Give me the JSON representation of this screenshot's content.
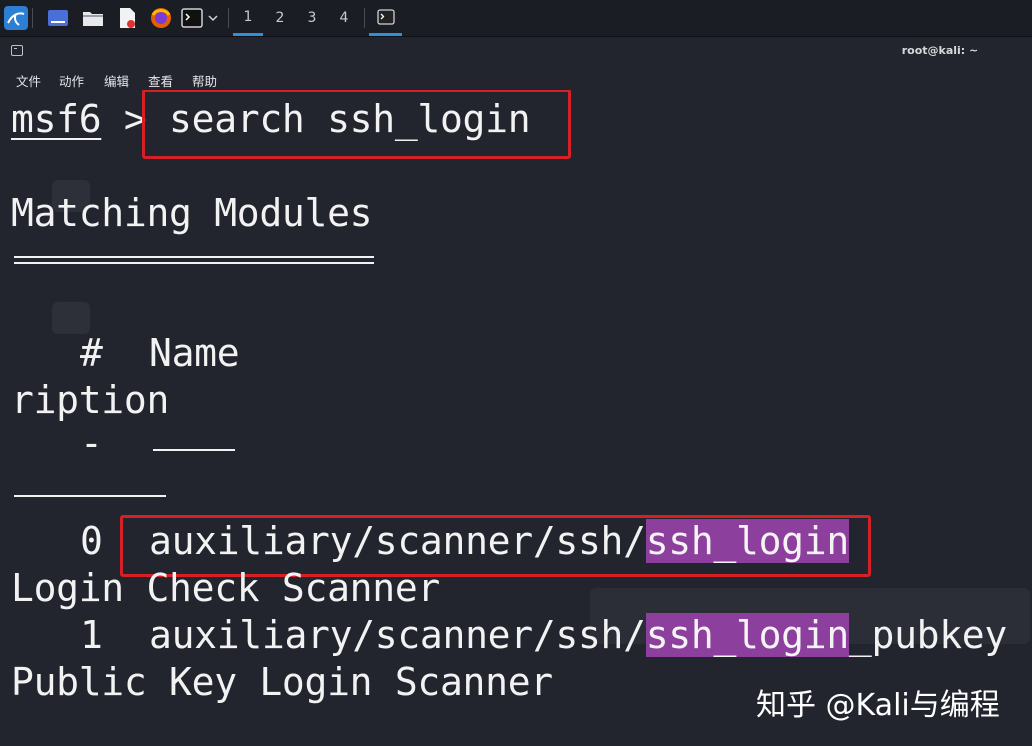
{
  "taskbar": {
    "workspaces": [
      "1",
      "2",
      "3",
      "4"
    ],
    "active_workspace": "1"
  },
  "window": {
    "title": "root@kali: ~"
  },
  "menu": {
    "items": [
      "文件",
      "动作",
      "编辑",
      "查看",
      "帮助"
    ]
  },
  "terminal": {
    "prompt": "msf6",
    "prompt_symbol": " >",
    "command": " search ssh_login",
    "heading": "Matching Modules",
    "col_hash": "#",
    "col_name": "Name",
    "wrapped_desc_header": "ription",
    "sep_hash": "-",
    "modules": [
      {
        "index": "0",
        "path_prefix": "auxiliary/scanner/ssh/",
        "match": "ssh_login",
        "suffix": "",
        "wrapped_desc": "Login Check Scanner"
      },
      {
        "index": "1",
        "path_prefix": "auxiliary/scanner/ssh/",
        "match": "ssh_login",
        "suffix": "_pubkey",
        "wrapped_desc": "Public Key Login Scanner"
      }
    ]
  },
  "watermark": {
    "text": "知乎 @Kali与编程"
  },
  "colors": {
    "background": "#23252e",
    "highlight": "#8d3f9e",
    "annotation_box": "#d71f26",
    "workspace_active": "#2f8fd8"
  }
}
